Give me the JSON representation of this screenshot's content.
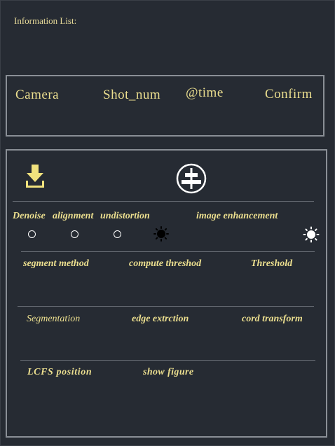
{
  "info_title": "Information List:",
  "header": {
    "camera": "Camera",
    "shot_num": "Shot_num",
    "time": "@time",
    "confirm": "Confirm"
  },
  "icons": {
    "download": "download-icon",
    "align": "align-center-icon",
    "dark_mode": "moon-sun-dark-icon",
    "brightness": "brightness-icon"
  },
  "options": {
    "denoise": "Denoise",
    "alignment": "alignment",
    "undistortion": "undistortion",
    "enhancement": "image enhancement"
  },
  "row_segment": {
    "method": "segment method",
    "compute": "compute threshod",
    "threshold": "Threshold"
  },
  "row_process": {
    "segmentation": "Segmentation",
    "edge": "edge extrction",
    "cord": "cord transform"
  },
  "row_output": {
    "lcfs": "LCFS position",
    "show": "show figure"
  },
  "colors": {
    "background": "#262b33",
    "text": "#ecdf8f",
    "border": "#8a8f96",
    "icon": "#f1e27d"
  }
}
